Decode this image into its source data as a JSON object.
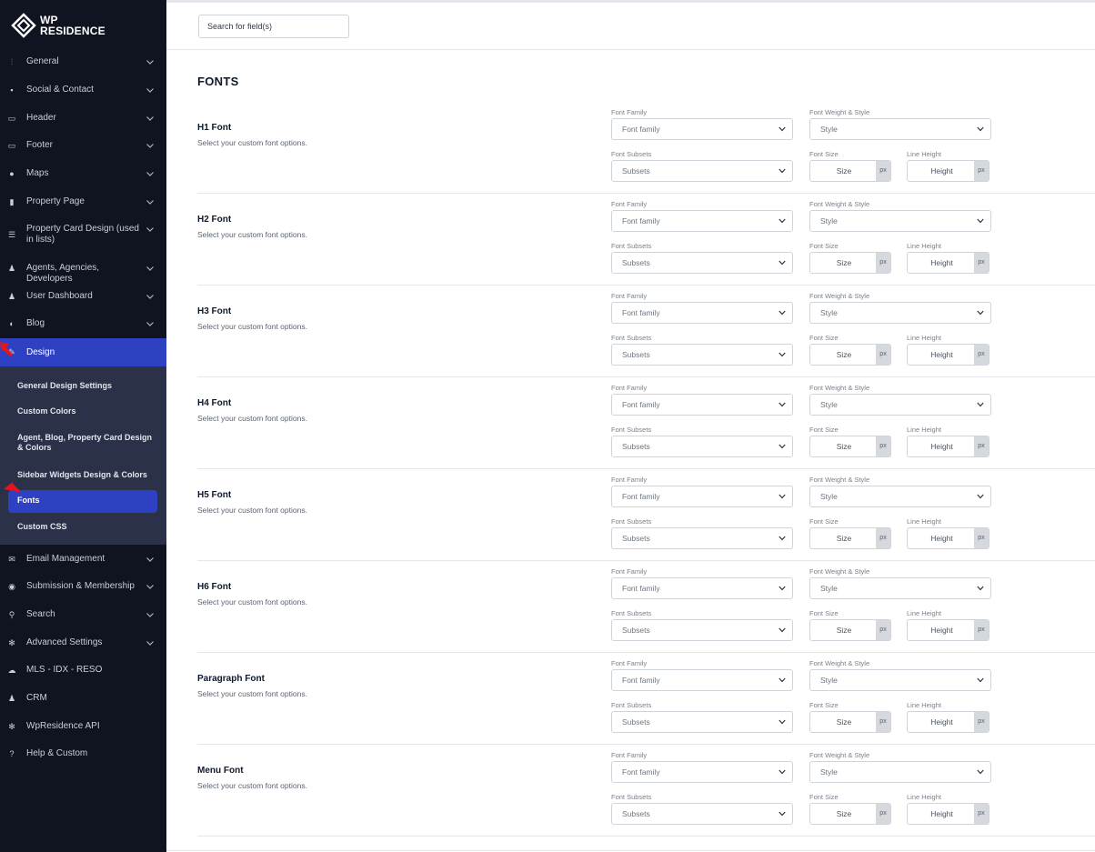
{
  "app": {
    "logo_line1": "WP",
    "logo_line2": "RESIDENCE"
  },
  "sidebar": {
    "items": [
      {
        "label": "General",
        "icon": "sliders-icon",
        "glyph": "⫶",
        "chevron": true
      },
      {
        "label": "Social & Contact",
        "icon": "contact-card-icon",
        "glyph": "▪",
        "chevron": true
      },
      {
        "label": "Header",
        "icon": "monitor-icon",
        "glyph": "▭",
        "chevron": true
      },
      {
        "label": "Footer",
        "icon": "desktop-icon",
        "glyph": "▭",
        "chevron": true
      },
      {
        "label": "Maps",
        "icon": "map-pin-icon",
        "glyph": "●",
        "chevron": true
      },
      {
        "label": "Property Page",
        "icon": "page-icon",
        "glyph": "▮",
        "chevron": true
      },
      {
        "label": "Property Card Design (used in lists)",
        "icon": "menu-lines-icon",
        "glyph": "☰",
        "chevron": true
      },
      {
        "label": "Agents, Agencies, Developers",
        "icon": "users-icon",
        "glyph": "♟",
        "chevron": true
      },
      {
        "label": "User Dashboard",
        "icon": "user-icon",
        "glyph": "♟",
        "chevron": true
      },
      {
        "label": "Blog",
        "icon": "contrast-icon",
        "glyph": "◐",
        "chevron": true
      },
      {
        "label": "Design",
        "icon": "brush-icon",
        "glyph": "✎",
        "chevron": false,
        "active": true
      },
      {
        "label": "Email Management",
        "icon": "envelope-icon",
        "glyph": "✉",
        "chevron": true
      },
      {
        "label": "Submission & Membership",
        "icon": "target-icon",
        "glyph": "◉",
        "chevron": true
      },
      {
        "label": "Search",
        "icon": "search-icon",
        "glyph": "⚲",
        "chevron": true
      },
      {
        "label": "Advanced Settings",
        "icon": "gear-icon",
        "glyph": "✻",
        "chevron": true
      },
      {
        "label": "MLS - IDX - RESO",
        "icon": "cloud-icon",
        "glyph": "☁",
        "chevron": false
      },
      {
        "label": "CRM",
        "icon": "users-group-icon",
        "glyph": "♟",
        "chevron": false
      },
      {
        "label": "WpResidence API",
        "icon": "cog-icon",
        "glyph": "✻",
        "chevron": false
      },
      {
        "label": "Help & Custom",
        "icon": "question-icon",
        "glyph": "?",
        "chevron": false
      }
    ],
    "submenu": [
      {
        "label": "General Design Settings"
      },
      {
        "label": "Custom Colors"
      },
      {
        "label": "Agent, Blog, Property Card Design & Colors"
      },
      {
        "label": "Sidebar Widgets Design & Colors"
      },
      {
        "label": "Fonts",
        "active": true
      },
      {
        "label": "Custom CSS"
      }
    ]
  },
  "search": {
    "placeholder": "Search for field(s)"
  },
  "main": {
    "section_title": "FONTS",
    "labels": {
      "font_family": "Font Family",
      "font_weight": "Font Weight & Style",
      "font_subsets": "Font Subsets",
      "font_size": "Font Size",
      "line_height": "Line Height"
    },
    "placeholders": {
      "family": "Font family",
      "style": "Style",
      "subsets": "Subsets",
      "size": "Size",
      "height": "Height",
      "unit": "px"
    },
    "fonts": [
      {
        "name": "H1 Font",
        "desc": "Select your custom font options."
      },
      {
        "name": "H2 Font",
        "desc": "Select your custom font options."
      },
      {
        "name": "H3 Font",
        "desc": "Select your custom font options."
      },
      {
        "name": "H4 Font",
        "desc": "Select your custom font options."
      },
      {
        "name": "H5 Font",
        "desc": "Select your custom font options."
      },
      {
        "name": "H6 Font",
        "desc": "Select your custom font options."
      },
      {
        "name": "Paragraph Font",
        "desc": "Select your custom font options."
      },
      {
        "name": "Menu Font",
        "desc": "Select your custom font options."
      }
    ]
  },
  "colors": {
    "sidebar_bg": "#0f1420",
    "accent": "#2e41c3",
    "submenu_bg": "#2a3148",
    "annotation_arrow": "#e8141c"
  }
}
